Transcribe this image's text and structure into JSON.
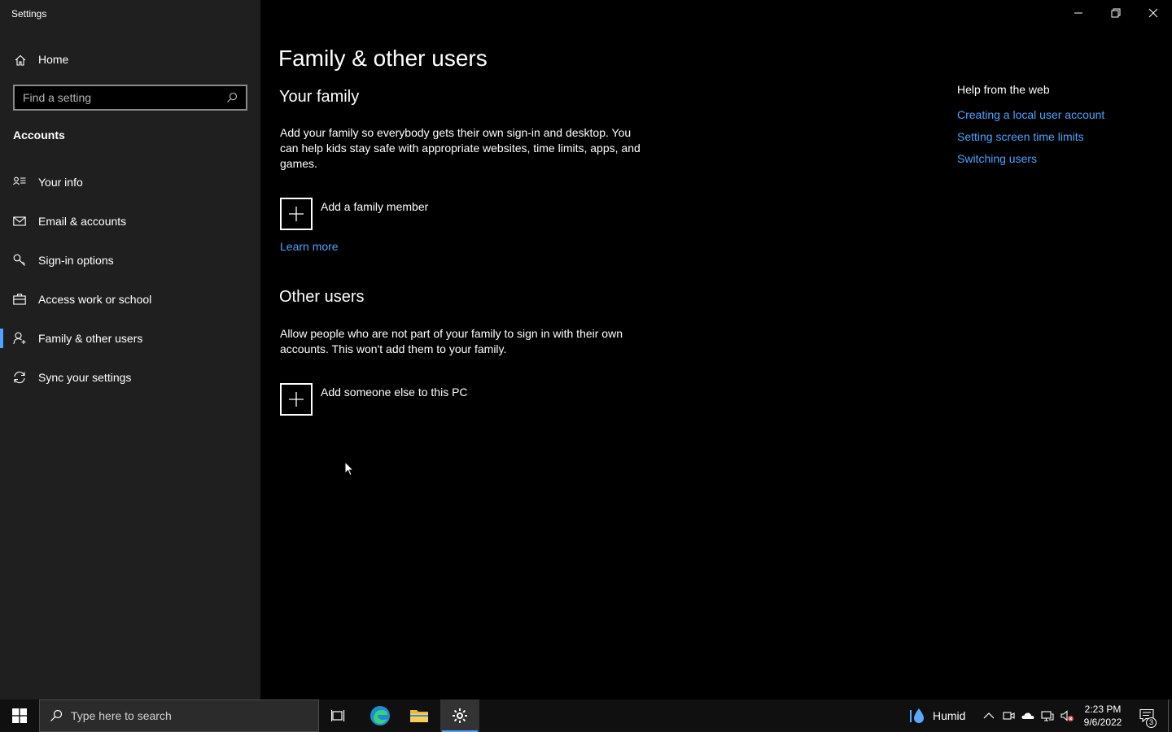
{
  "window": {
    "title": "Settings",
    "controls": [
      "minimize",
      "restore",
      "close"
    ]
  },
  "sidebar": {
    "home_label": "Home",
    "search_placeholder": "Find a setting",
    "section_label": "Accounts",
    "items": [
      {
        "label": "Your info",
        "icon": "person-card-icon",
        "selected": false
      },
      {
        "label": "Email & accounts",
        "icon": "mail-icon",
        "selected": false
      },
      {
        "label": "Sign-in options",
        "icon": "key-icon",
        "selected": false
      },
      {
        "label": "Access work or school",
        "icon": "briefcase-icon",
        "selected": false
      },
      {
        "label": "Family & other users",
        "icon": "person-add-icon",
        "selected": true
      },
      {
        "label": "Sync your settings",
        "icon": "sync-icon",
        "selected": false
      }
    ]
  },
  "main": {
    "page_title": "Family & other users",
    "your_family": {
      "heading": "Your family",
      "description": "Add your family so everybody gets their own sign-in and desktop. You can help kids stay safe with appropriate websites, time limits, apps, and games.",
      "add_label": "Add a family member",
      "learn_more": "Learn more"
    },
    "other_users": {
      "heading": "Other users",
      "description": "Allow people who are not part of your family to sign in with their own accounts. This won't add them to your family.",
      "add_label": "Add someone else to this PC"
    },
    "help": {
      "title": "Help from the web",
      "links": [
        "Creating a local user account",
        "Setting screen time limits",
        "Switching users"
      ]
    }
  },
  "taskbar": {
    "search_placeholder": "Type here to search",
    "weather_label": "Humid",
    "time": "2:23 PM",
    "date": "9/6/2022",
    "notification_count": "3"
  },
  "colors": {
    "accent": "#4da3ff",
    "sidebar_bg": "#1f1f1f",
    "main_bg": "#000000",
    "taskbar_bg": "#101010"
  }
}
